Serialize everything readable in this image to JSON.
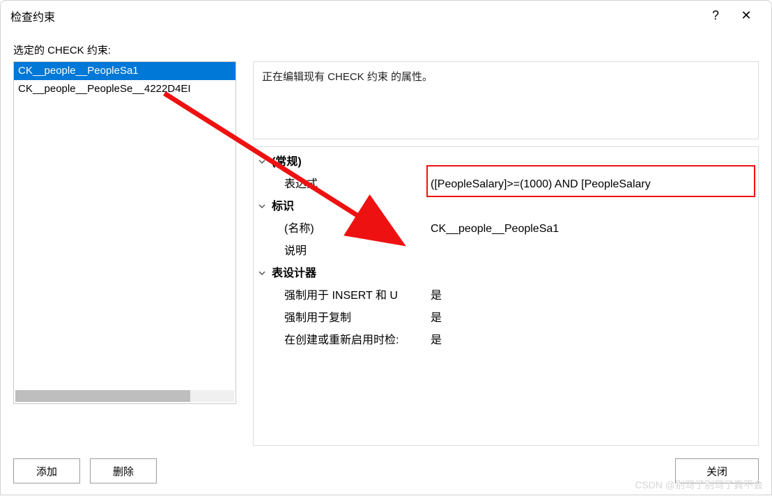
{
  "titlebar": {
    "title": "检查约束",
    "help_symbol": "?",
    "close_symbol": "✕"
  },
  "list": {
    "label": "选定的 CHECK 约束:",
    "items": [
      {
        "label": "CK__people__PeopleSa1",
        "selected": true
      },
      {
        "label": "CK__people__PeopleSe__4222D4EI",
        "selected": false
      }
    ]
  },
  "description": "正在编辑现有 CHECK 约束 的属性。",
  "properties": {
    "categories": [
      {
        "name": "(常规)",
        "rows": [
          {
            "label": "表达式",
            "value": "([PeopleSalary]>=(1000) AND [PeopleSalary"
          }
        ]
      },
      {
        "name": "标识",
        "rows": [
          {
            "label": "(名称)",
            "value": "CK__people__PeopleSa1"
          },
          {
            "label": "说明",
            "value": ""
          }
        ]
      },
      {
        "name": "表设计器",
        "rows": [
          {
            "label": "强制用于 INSERT 和 U",
            "value": "是"
          },
          {
            "label": "强制用于复制",
            "value": "是"
          },
          {
            "label": "在创建或重新启用时检:",
            "value": "是"
          }
        ]
      }
    ]
  },
  "buttons": {
    "add": "添加",
    "delete": "删除",
    "close": "关闭"
  },
  "watermark": "CSDN @别骂了别骂了真不会",
  "highlight": {
    "color": "#e11"
  }
}
